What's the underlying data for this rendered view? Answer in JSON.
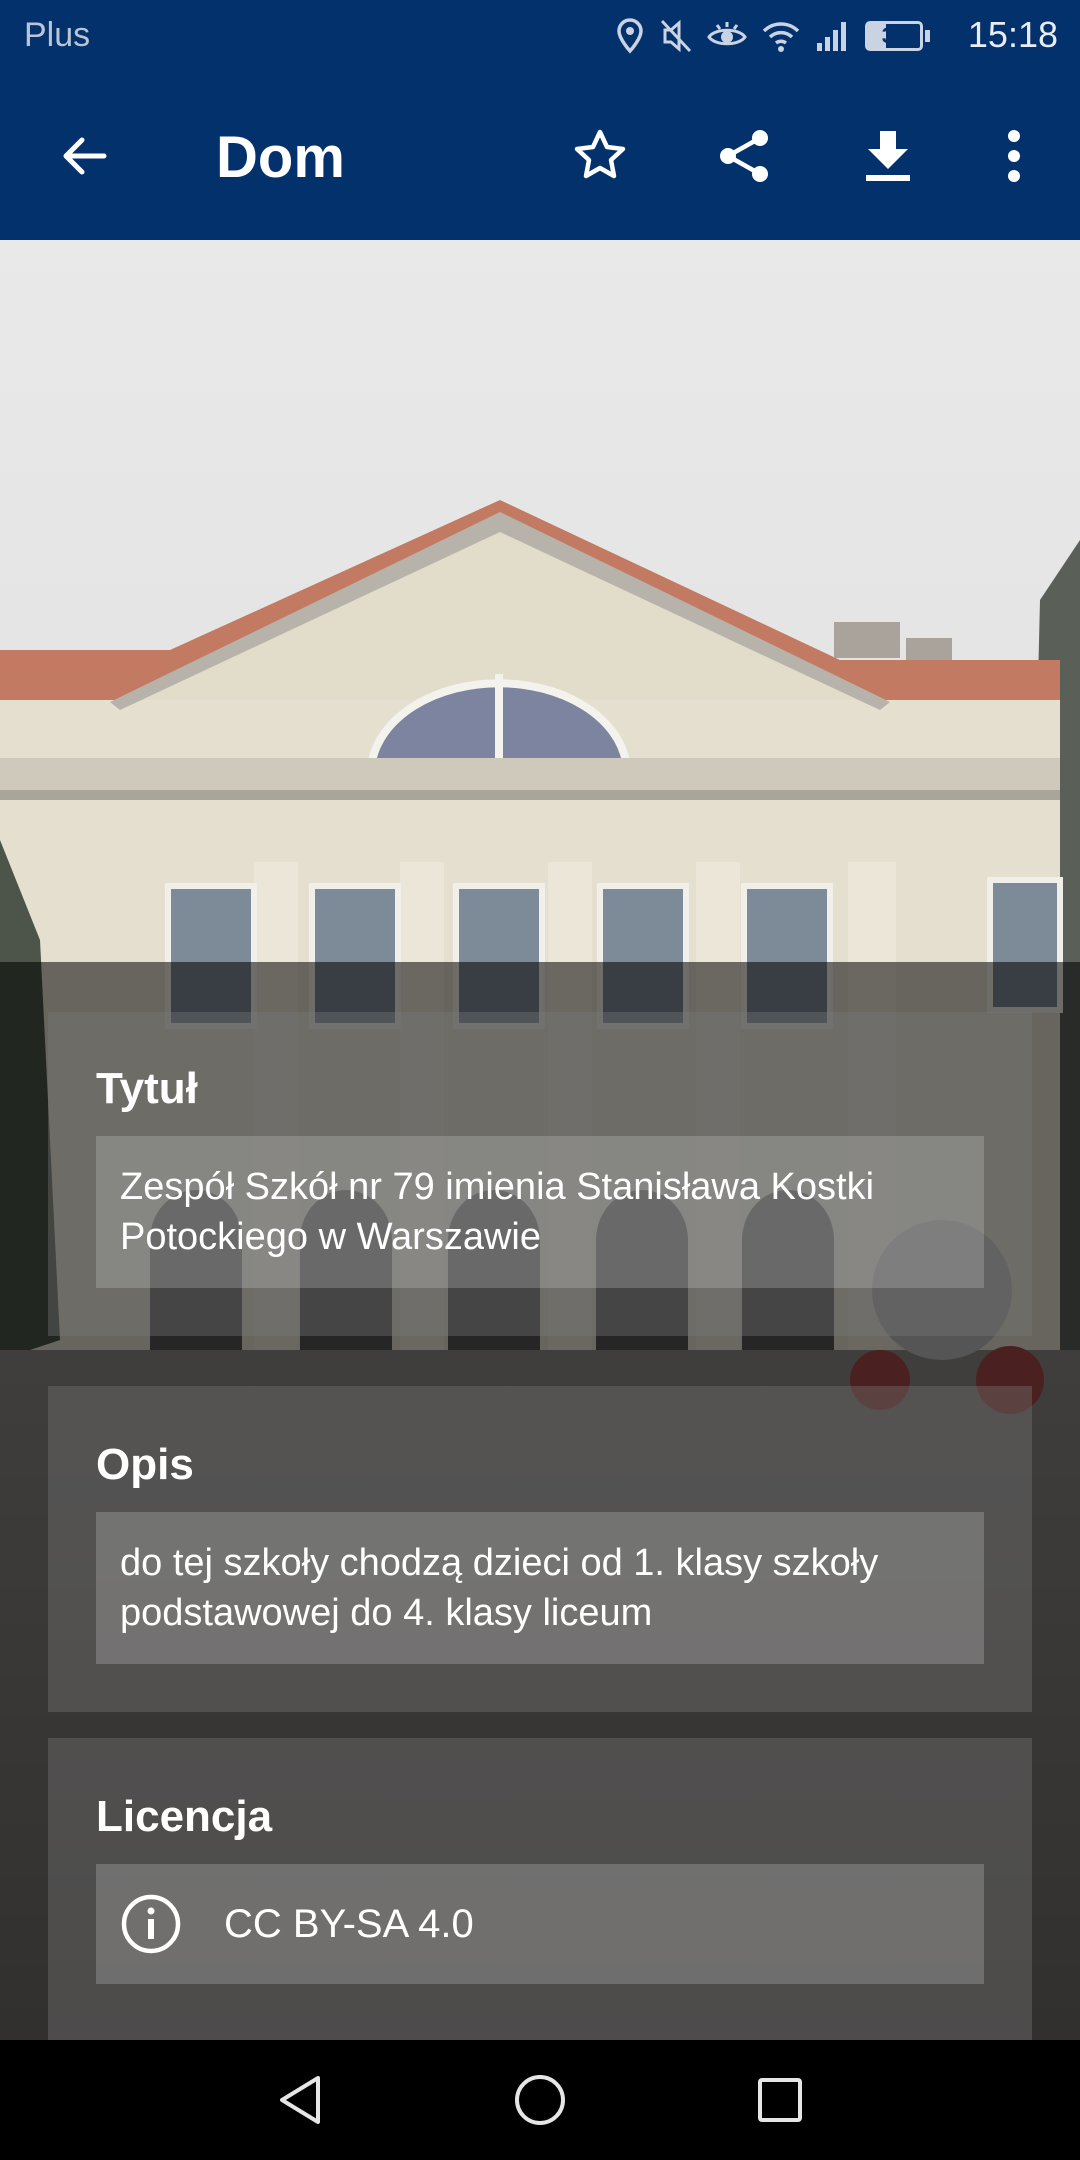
{
  "status_bar": {
    "carrier": "Plus",
    "battery_level": "35",
    "battery_fraction": 0.35,
    "time": "15:18",
    "icons": [
      "location-icon",
      "mute-icon",
      "eye-comfort-icon",
      "wifi-icon",
      "signal-icon",
      "battery-icon"
    ]
  },
  "app_bar": {
    "title": "Dom",
    "actions": [
      "back-arrow-icon",
      "star-icon",
      "share-icon",
      "download-icon",
      "more-vert-icon"
    ]
  },
  "details": {
    "title_label": "Tytuł",
    "title_value": "Zespół Szkół nr 79 imienia Stanisława Kostki Potockiego w Warszawie",
    "description_label": "Opis",
    "description_value": "do tej szkoły chodzą dzieci od 1. klasy szkoły podstawowej do 4. klasy liceum",
    "license_label": "Licencja",
    "license_value": "CC BY-SA 4.0"
  },
  "nav_bar": {
    "buttons": [
      "back-triangle-icon",
      "home-circle-icon",
      "recents-square-icon"
    ]
  },
  "colors": {
    "primary": "#03316b",
    "text_on_dark": "#ffffff"
  }
}
